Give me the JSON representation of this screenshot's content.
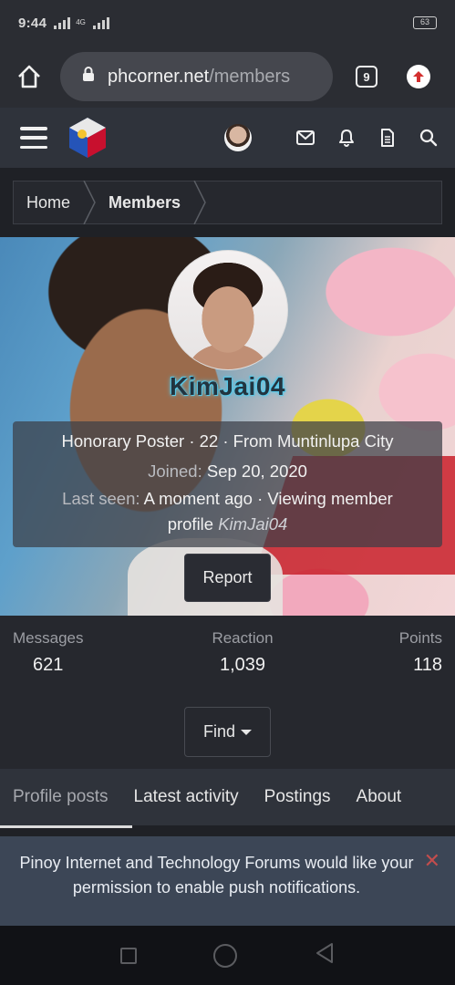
{
  "status_bar": {
    "time": "9:44",
    "network": "4G",
    "battery": "63"
  },
  "browser": {
    "url_host": "phcorner.net",
    "url_path": "/members",
    "tab_count": "9",
    "icons": [
      "home-icon",
      "lock-icon",
      "update-icon"
    ]
  },
  "header": {
    "icons": [
      "menu-icon",
      "site-logo",
      "avatar",
      "mail-icon",
      "bell-icon",
      "document-icon",
      "search-icon"
    ]
  },
  "breadcrumb": {
    "items": [
      "Home",
      "Members"
    ]
  },
  "profile": {
    "username": "KimJai04",
    "line1": "Honorary Poster · 22 · From Muntinlupa City",
    "joined_label": "Joined:",
    "joined_value": "Sep 20, 2020",
    "last_seen_label": "Last seen:",
    "last_seen_value": "A moment ago · Viewing member",
    "last_seen_value2": "profile",
    "last_seen_user": "KimJai04",
    "report_label": "Report"
  },
  "stats": {
    "messages_label": "Messages",
    "messages_value": "621",
    "reaction_label": "Reaction",
    "reaction_value": "1,039",
    "points_label": "Points",
    "points_value": "118"
  },
  "find_label": "Find",
  "tabs": [
    "Profile posts",
    "Latest activity",
    "Postings",
    "About"
  ],
  "notification": {
    "text": "Pinoy Internet and Technology Forums would like your permission to enable push notifications."
  },
  "colors": {
    "background": "#1f2126",
    "header": "#2f333b",
    "notification": "#3c4656",
    "close": "#c24d4d"
  }
}
